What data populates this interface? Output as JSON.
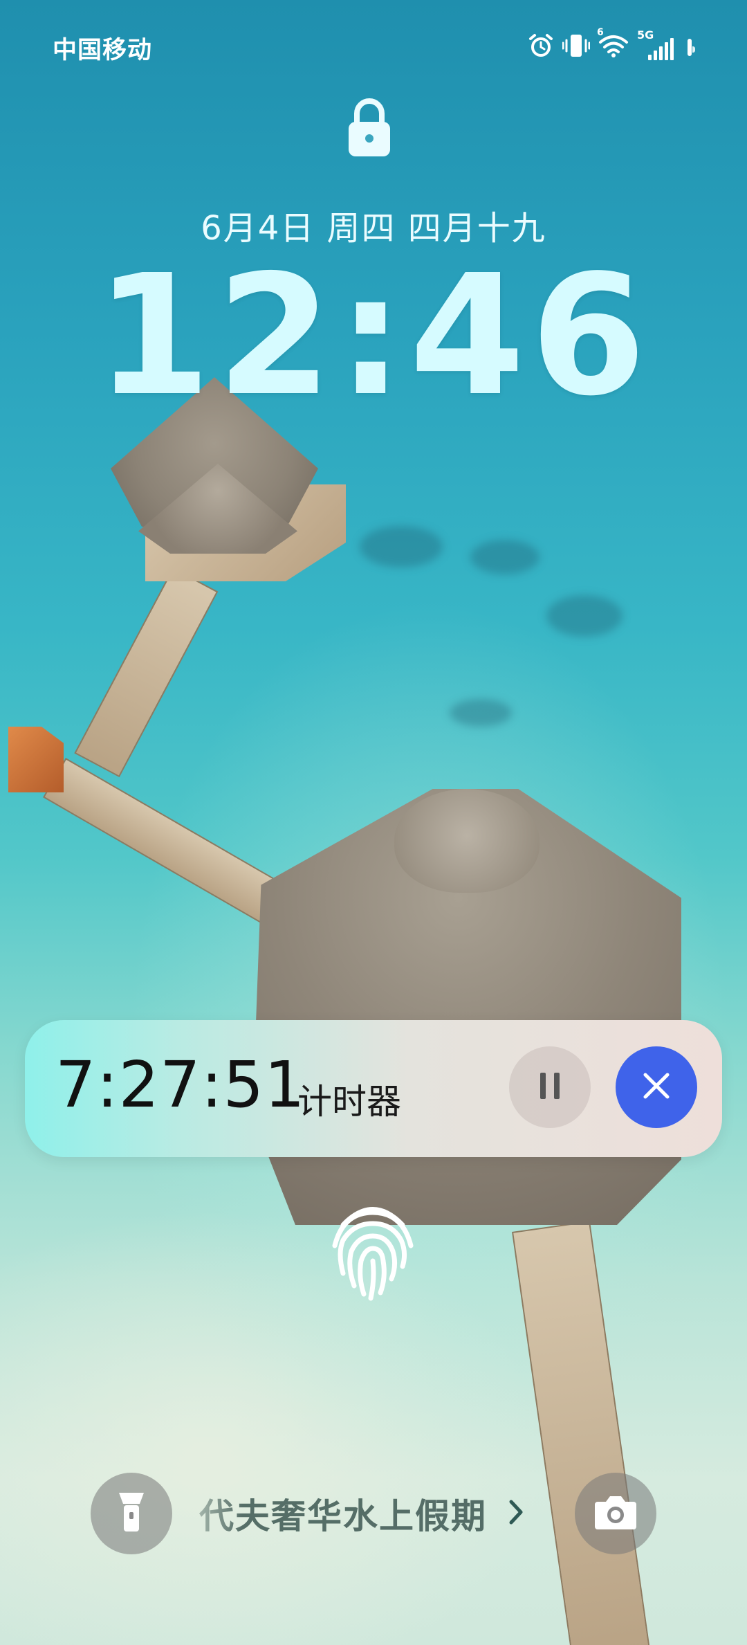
{
  "status_bar": {
    "carrier": "中国移动",
    "network_type": "5G",
    "wifi_badge": "6",
    "battery_percent": 85,
    "icons": [
      "alarm-icon",
      "vibrate-icon",
      "wifi-icon",
      "signal-icon",
      "battery-icon"
    ]
  },
  "lockscreen": {
    "date_line": "6月4日 周四 四月十九",
    "time": "12:46",
    "lock_icon": "lock-icon"
  },
  "timer_card": {
    "elapsed": "7:27:51",
    "label": "计时器",
    "pause_icon": "pause-icon",
    "close_icon": "close-icon",
    "accent_color": "#3f63ea"
  },
  "fingerprint": {
    "icon": "fingerprint-icon"
  },
  "bottom_bar": {
    "flashlight_icon": "flashlight-icon",
    "promo_text": "代夫奢华水上假期",
    "promo_arrow_icon": "chevron-right-icon",
    "camera_icon": "camera-icon"
  }
}
